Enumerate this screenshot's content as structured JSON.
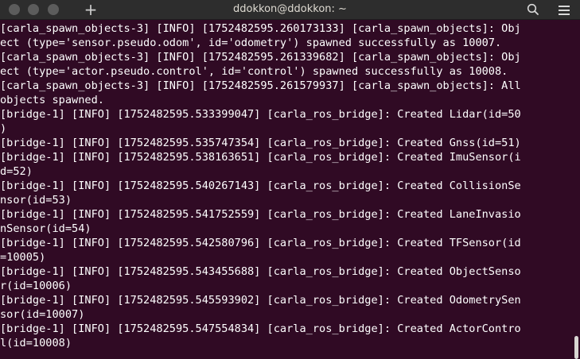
{
  "window": {
    "title": "ddokkon@ddokkon: ~",
    "new_tab_glyph": "+",
    "icons": {
      "close": "close-icon",
      "minimize": "minimize-icon",
      "maximize": "maximize-icon",
      "new_tab": "plus-icon",
      "search": "search-icon",
      "menu": "hamburger-menu-icon"
    }
  },
  "colors": {
    "terminal_background": "#300a24",
    "terminal_text": "#ffffff",
    "titlebar_background": "#2d2d2d"
  },
  "terminal": {
    "lines": [
      "[carla_spawn_objects-3] [INFO] [1752482595.260173133] [carla_spawn_objects]: Obj",
      "ect (type='sensor.pseudo.odom', id='odometry') spawned successfully as 10007.",
      "[carla_spawn_objects-3] [INFO] [1752482595.261339682] [carla_spawn_objects]: Obj",
      "ect (type='actor.pseudo.control', id='control') spawned successfully as 10008.",
      "[carla_spawn_objects-3] [INFO] [1752482595.261579937] [carla_spawn_objects]: All",
      "objects spawned.",
      "[bridge-1] [INFO] [1752482595.533399047] [carla_ros_bridge]: Created Lidar(id=50",
      ")",
      "[bridge-1] [INFO] [1752482595.535747354] [carla_ros_bridge]: Created Gnss(id=51)",
      "[bridge-1] [INFO] [1752482595.538163651] [carla_ros_bridge]: Created ImuSensor(i",
      "d=52)",
      "[bridge-1] [INFO] [1752482595.540267143] [carla_ros_bridge]: Created CollisionSe",
      "nsor(id=53)",
      "[bridge-1] [INFO] [1752482595.541752559] [carla_ros_bridge]: Created LaneInvasio",
      "nSensor(id=54)",
      "[bridge-1] [INFO] [1752482595.542580796] [carla_ros_bridge]: Created TFSensor(id",
      "=10005)",
      "[bridge-1] [INFO] [1752482595.543455688] [carla_ros_bridge]: Created ObjectSenso",
      "r(id=10006)",
      "[bridge-1] [INFO] [1752482595.545593902] [carla_ros_bridge]: Created OdometrySen",
      "sor(id=10007)",
      "[bridge-1] [INFO] [1752482595.547554834] [carla_ros_bridge]: Created ActorContro",
      "l(id=10008)"
    ]
  }
}
